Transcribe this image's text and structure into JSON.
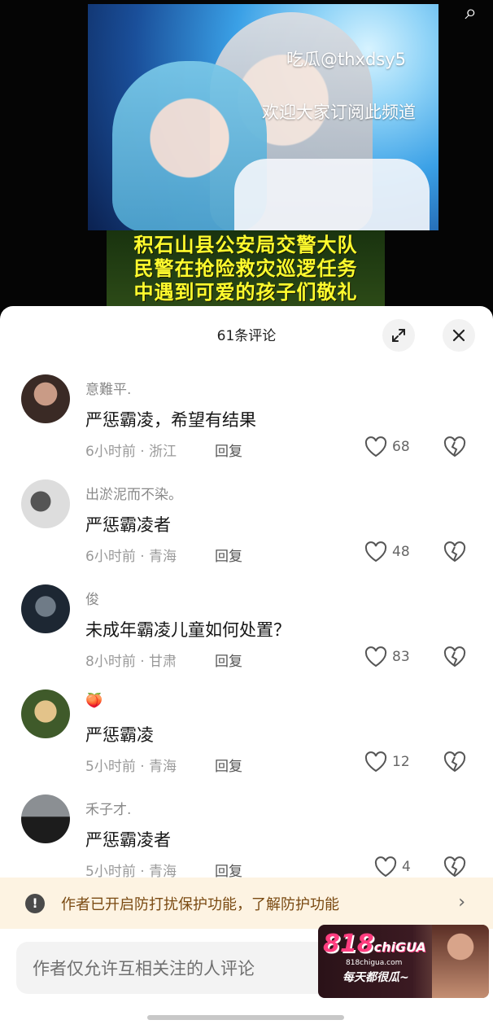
{
  "video": {
    "overlay_line1": "吃瓜@thxdsy5",
    "overlay_line2": "欢迎大家订阅此频道",
    "subtitles": [
      "积石山县公安局交警大队",
      "民警在抢险救灾巡逻任务",
      "中遇到可爱的孩子们敬礼"
    ]
  },
  "sheet": {
    "title": "61条评论",
    "expand_icon": "expand-icon",
    "close_icon": "close-icon"
  },
  "comments": [
    {
      "username": "意難平.",
      "text": "严惩霸凌，希望有结果",
      "time": "6小时前",
      "location": "浙江",
      "reply": "回复",
      "likes": "68",
      "avatar_colors": [
        "#3a2a25",
        "#c99b86"
      ]
    },
    {
      "username": "出淤泥而不染。",
      "text": "严惩霸凌者",
      "time": "6小时前",
      "location": "青海",
      "reply": "回复",
      "likes": "48",
      "avatar_colors": [
        "#ddd",
        "#555"
      ]
    },
    {
      "username": "俊",
      "text": "未成年霸凌儿童如何处置？",
      "time": "8小时前",
      "location": "甘肃",
      "reply": "回复",
      "likes": "83",
      "avatar_colors": [
        "#1d2733",
        "#6f7b87"
      ]
    },
    {
      "username": "🍑",
      "text": "严惩霸凌",
      "time": "5小时前",
      "location": "青海",
      "reply": "回复",
      "likes": "12",
      "avatar_colors": [
        "#3f5a2a",
        "#e3c38a"
      ]
    },
    {
      "username": "禾子才.",
      "text": "严惩霸凌者",
      "time": "5小时前",
      "location": "青海",
      "reply": "回复",
      "likes": "4",
      "avatar_colors": [
        "#1c1c1c",
        "#8b8f93"
      ]
    }
  ],
  "notice": {
    "icon": "exclamation-icon",
    "text": "作者已开启防打扰保护功能，了解防护功能"
  },
  "input": {
    "placeholder": "作者仅允许互相关注的人评论"
  },
  "ad": {
    "logo": "818",
    "logo_suffix": "chiGUA",
    "site": "818chigua.com",
    "slogan": "每天都很瓜~"
  }
}
